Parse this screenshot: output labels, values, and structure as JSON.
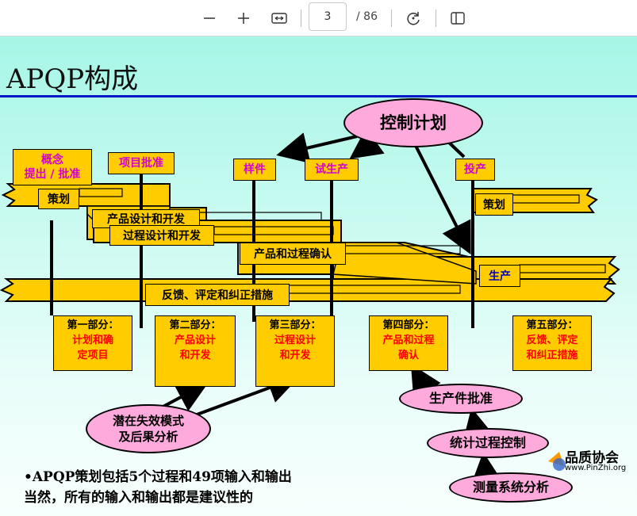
{
  "toolbar": {
    "zoom_out_icon": "minus-icon",
    "zoom_in_icon": "plus-icon",
    "fit_icon": "fit-width-icon",
    "current_page": "3",
    "total_pages": "/ 86",
    "rotate_icon": "rotate-icon",
    "sidebar_icon": "page-view-icon"
  },
  "slide": {
    "title": "APQP构成",
    "milestones": {
      "concept": "概念\n提出 / 批准",
      "project_approval": "项目批准",
      "sample": "样件",
      "pilot": "试生产",
      "launch": "投产"
    },
    "control_plan": "控制计划",
    "bands": {
      "planning": "策划",
      "product_design": "产品设计和开发",
      "process_design": "过程设计和开发",
      "validation": "产品和过程确认",
      "feedback": "反馈、评定和纠正措施",
      "planning_2": "策划",
      "production": "生产"
    },
    "sections": [
      {
        "head": "第一部分：",
        "body": "计划和确\n定项目"
      },
      {
        "head": "第二部分：",
        "body": "产品设计\n和开发"
      },
      {
        "head": "第三部分：",
        "body": "过程设计\n和开发"
      },
      {
        "head": "第四部分：",
        "body": "产品和过程\n确认"
      },
      {
        "head": "第五部分：",
        "body": "反馈、评定\n和纠正措施"
      }
    ],
    "ovals": {
      "fmea": "潜在失效模式\n及后果分析",
      "ppap": "生产件批准",
      "spc": "统计过程控制",
      "msa": "测量系统分析"
    },
    "note_line1": "•APQP策划包括5个过程和49项输入和输出",
    "note_line2": "当然，所有的输入和输出都是建议性的"
  },
  "watermark": {
    "name": "品质协会",
    "url": "www.PinZhi.org"
  },
  "colors": {
    "band": "#ffcc00",
    "magenta_text": "#d400d4",
    "red_text": "#ff0000",
    "oval": "#ffaadd",
    "title_rule": "#0018c8"
  }
}
